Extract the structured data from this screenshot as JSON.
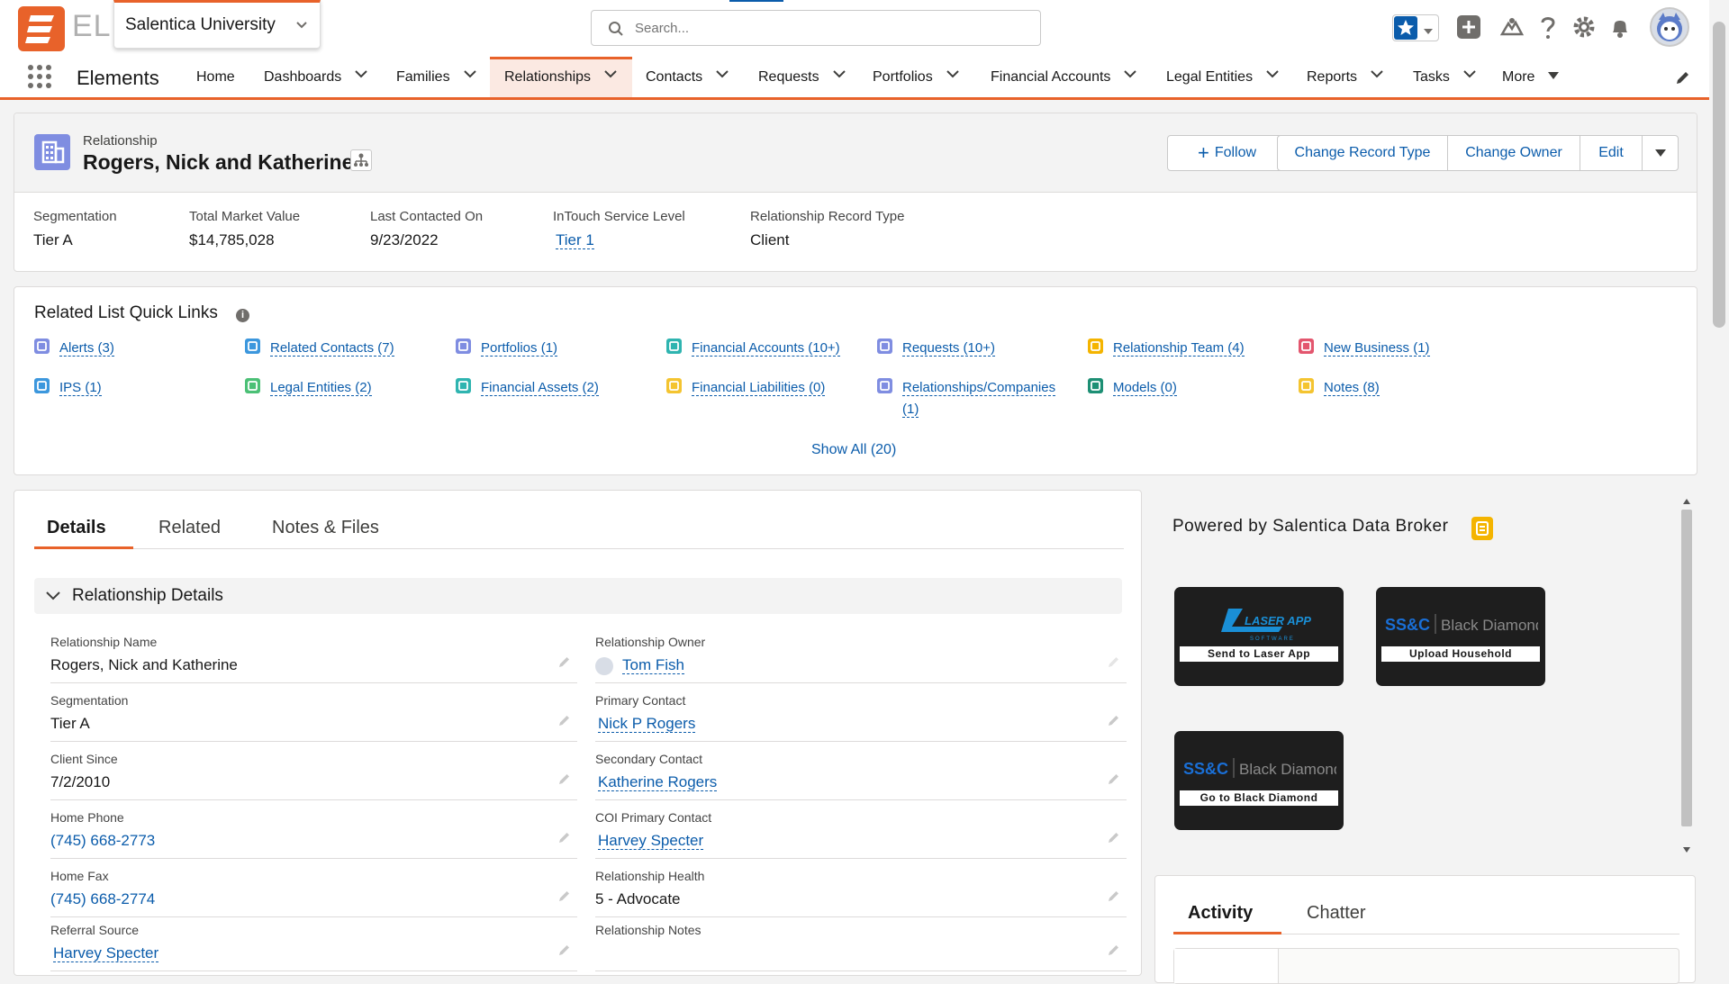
{
  "header": {
    "logo_text": "EL",
    "org_name": "Salentica University",
    "search_placeholder": "Search..."
  },
  "nav": {
    "app_name": "Elements",
    "items": [
      {
        "label": "Home"
      },
      {
        "label": "Dashboards"
      },
      {
        "label": "Families"
      },
      {
        "label": "Relationships"
      },
      {
        "label": "Contacts"
      },
      {
        "label": "Requests"
      },
      {
        "label": "Portfolios"
      },
      {
        "label": "Financial Accounts"
      },
      {
        "label": "Legal Entities"
      },
      {
        "label": "Reports"
      },
      {
        "label": "Tasks"
      },
      {
        "label": "More"
      }
    ]
  },
  "record": {
    "object_label": "Relationship",
    "name": "Rogers, Nick and Katherine",
    "buttons": {
      "follow": "Follow",
      "change_record_type": "Change Record Type",
      "change_owner": "Change Owner",
      "edit": "Edit"
    },
    "highlights": [
      {
        "label": "Segmentation",
        "value": "Tier A"
      },
      {
        "label": "Total Market Value",
        "value": "$14,785,028"
      },
      {
        "label": "Last Contacted On",
        "value": "9/23/2022"
      },
      {
        "label": "InTouch Service Level",
        "value": "Tier 1"
      },
      {
        "label": "Relationship Record Type",
        "value": "Client"
      }
    ]
  },
  "quick_links": {
    "title": "Related List Quick Links",
    "info_glyph": "i",
    "show_all": "Show All (20)",
    "items": [
      {
        "label": "Alerts (3)",
        "color": "#7f8de1"
      },
      {
        "label": "Related Contacts (7)",
        "color": "#3c97dd"
      },
      {
        "label": "Portfolios (1)",
        "color": "#7f8de1"
      },
      {
        "label": "Financial Accounts (10+)",
        "color": "#2fb4b0"
      },
      {
        "label": "Requests (10+)",
        "color": "#7f8de1"
      },
      {
        "label": "Relationship Team (4)",
        "color": "#f4b400"
      },
      {
        "label": "New Business (1)",
        "color": "#e3566e"
      },
      {
        "label": "IPS (1)",
        "color": "#3c97dd"
      },
      {
        "label": "Legal Entities (2)",
        "color": "#4bc076"
      },
      {
        "label": "Financial Assets (2)",
        "color": "#2fb4b0"
      },
      {
        "label": "Financial Liabilities (0)",
        "color": "#f4c430"
      },
      {
        "label": "Relationships/Companies",
        "label2": "(1)",
        "color": "#7f8de1"
      },
      {
        "label": "Models (0)",
        "color": "#1d8f74"
      },
      {
        "label": "Notes (8)",
        "color": "#f4c430"
      }
    ]
  },
  "details": {
    "tabs": [
      {
        "label": "Details"
      },
      {
        "label": "Related"
      },
      {
        "label": "Notes & Files"
      }
    ],
    "section_title": "Relationship Details",
    "left_fields": [
      {
        "label": "Relationship Name",
        "value": "Rogers, Nick and Katherine"
      },
      {
        "label": "Segmentation",
        "value": "Tier A"
      },
      {
        "label": "Client Since",
        "value": "7/2/2010"
      },
      {
        "label": "Home Phone",
        "value": "(745) 668-2773"
      },
      {
        "label": "Home Fax",
        "value": "(745) 668-2774"
      },
      {
        "label": "Referral Source",
        "value": "Harvey Specter"
      }
    ],
    "right_fields": [
      {
        "label": "Relationship Owner",
        "value": "Tom Fish"
      },
      {
        "label": "Primary Contact",
        "value": "Nick P Rogers"
      },
      {
        "label": "Secondary Contact",
        "value": "Katherine Rogers"
      },
      {
        "label": "COI Primary Contact",
        "value": "Harvey Specter"
      },
      {
        "label": "Relationship Health",
        "value": "5 - Advocate"
      },
      {
        "label": "Relationship Notes",
        "value": ""
      }
    ]
  },
  "right_panel": {
    "title": "Powered by Salentica Data Broker",
    "tiles": [
      {
        "brand": "LASER APP",
        "brand_sub": "SOFTWARE",
        "caption": "Send to Laser App"
      },
      {
        "brand_ss": "SS&C",
        "brand": "Black Diamond",
        "caption": "Upload Household"
      },
      {
        "brand_ss": "SS&C",
        "brand": "Black Diamond",
        "caption": "Go to Black Diamond"
      }
    ]
  },
  "activity": {
    "tabs": [
      {
        "label": "Activity"
      },
      {
        "label": "Chatter"
      }
    ]
  },
  "colors": {
    "accent": "#e8622a",
    "link": "#0b5cab",
    "record_icon": "#7f8de1"
  }
}
